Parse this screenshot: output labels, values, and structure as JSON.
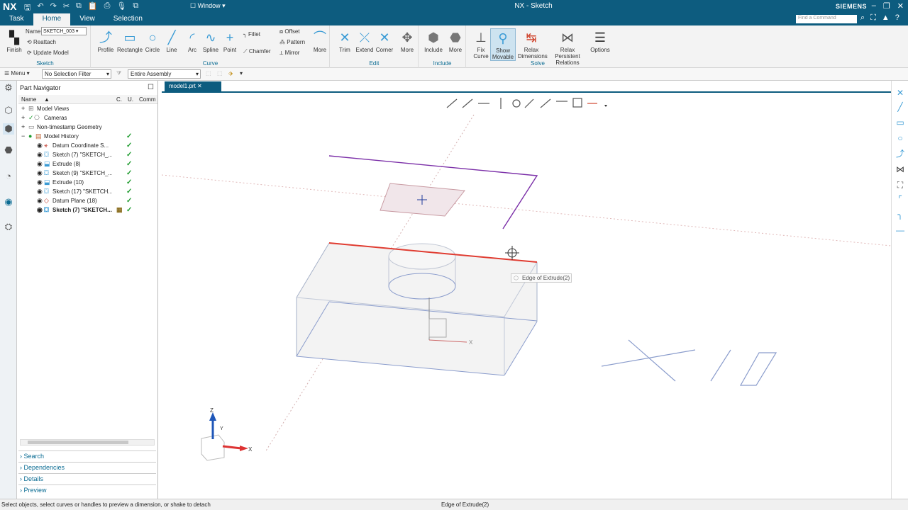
{
  "app": {
    "logo": "NX",
    "title": "NX - Sketch",
    "brand": "SIEMENS",
    "window_menu": "Window",
    "find_command_placeholder": "Find a Command"
  },
  "tabs": [
    {
      "label": "Task"
    },
    {
      "label": "Home"
    },
    {
      "label": "View"
    },
    {
      "label": "Selection"
    }
  ],
  "ribbon": {
    "sketch_group": {
      "label": "Sketch",
      "finish": "Finish",
      "name_label": "Name",
      "name_value": "SKETCH_003",
      "reattach": "Reattach",
      "update_model": "Update Model"
    },
    "curve_group": {
      "label": "Curve",
      "buttons": [
        "Profile",
        "Rectangle",
        "Circle",
        "Line",
        "Arc",
        "Spline",
        "Point"
      ],
      "fillet": "Fillet",
      "chamfer": "Chamfer",
      "offset": "Offset",
      "pattern": "Pattern",
      "mirror": "Mirror",
      "more": "More"
    },
    "edit_group": {
      "label": "Edit",
      "buttons": [
        "Trim",
        "Extend",
        "Corner",
        "More"
      ]
    },
    "include_group": {
      "label": "Include",
      "buttons": [
        "Include",
        "More"
      ]
    },
    "solve_group": {
      "label": "Solve",
      "fix_curve": [
        "Fix",
        "Curve"
      ],
      "show_movable": [
        "Show",
        "Movable"
      ],
      "relax_dimensions": [
        "Relax",
        "Dimensions"
      ],
      "relax_persistent": [
        "Relax Persistent",
        "Relations"
      ],
      "options": "Options"
    }
  },
  "filterbar": {
    "menu": "Menu",
    "selection_filter": "No Selection Filter",
    "scope": "Entire Assembly"
  },
  "navigator": {
    "title": "Part Navigator",
    "columns": [
      "Name",
      "C.",
      "U.",
      "Comm"
    ],
    "rows": [
      {
        "label": "Model Views",
        "check": ""
      },
      {
        "label": "Cameras",
        "check": ""
      },
      {
        "label": "Non-timestamp Geometry",
        "check": ""
      },
      {
        "label": "Model History",
        "check": "✓"
      },
      {
        "label": "Datum Coordinate S...",
        "check": "✓"
      },
      {
        "label": "Sketch (7) \"SKETCH_...",
        "check": "✓"
      },
      {
        "label": "Extrude (8)",
        "check": "✓"
      },
      {
        "label": "Sketch (9) \"SKETCH_...",
        "check": "✓"
      },
      {
        "label": "Extrude (10)",
        "check": "✓"
      },
      {
        "label": "Sketch (17) \"SKETCH...",
        "check": "✓"
      },
      {
        "label": "Datum Plane (18)",
        "check": "✓"
      },
      {
        "label": "Sketch (7) \"SKETCH...",
        "check": "✓"
      }
    ],
    "sections": [
      "Search",
      "Dependencies",
      "Details",
      "Preview"
    ]
  },
  "viewport": {
    "doc_tab": "model1.prt",
    "tooltip": "Edge of Extrude(2)",
    "triad": {
      "x": "X",
      "y": "Y",
      "z": "Z"
    }
  },
  "status": {
    "prompt": "Select objects, select curves or handles to preview a dimension, or shake to detach",
    "selection": "Edge of Extrude(2)"
  },
  "colors": {
    "titlebar": "#0d5c7f",
    "accent": "#3a9bd5",
    "highlight_edge": "#e03c31",
    "sketch_curve": "#7b2fa8",
    "body_edge": "#8a9ccc"
  }
}
